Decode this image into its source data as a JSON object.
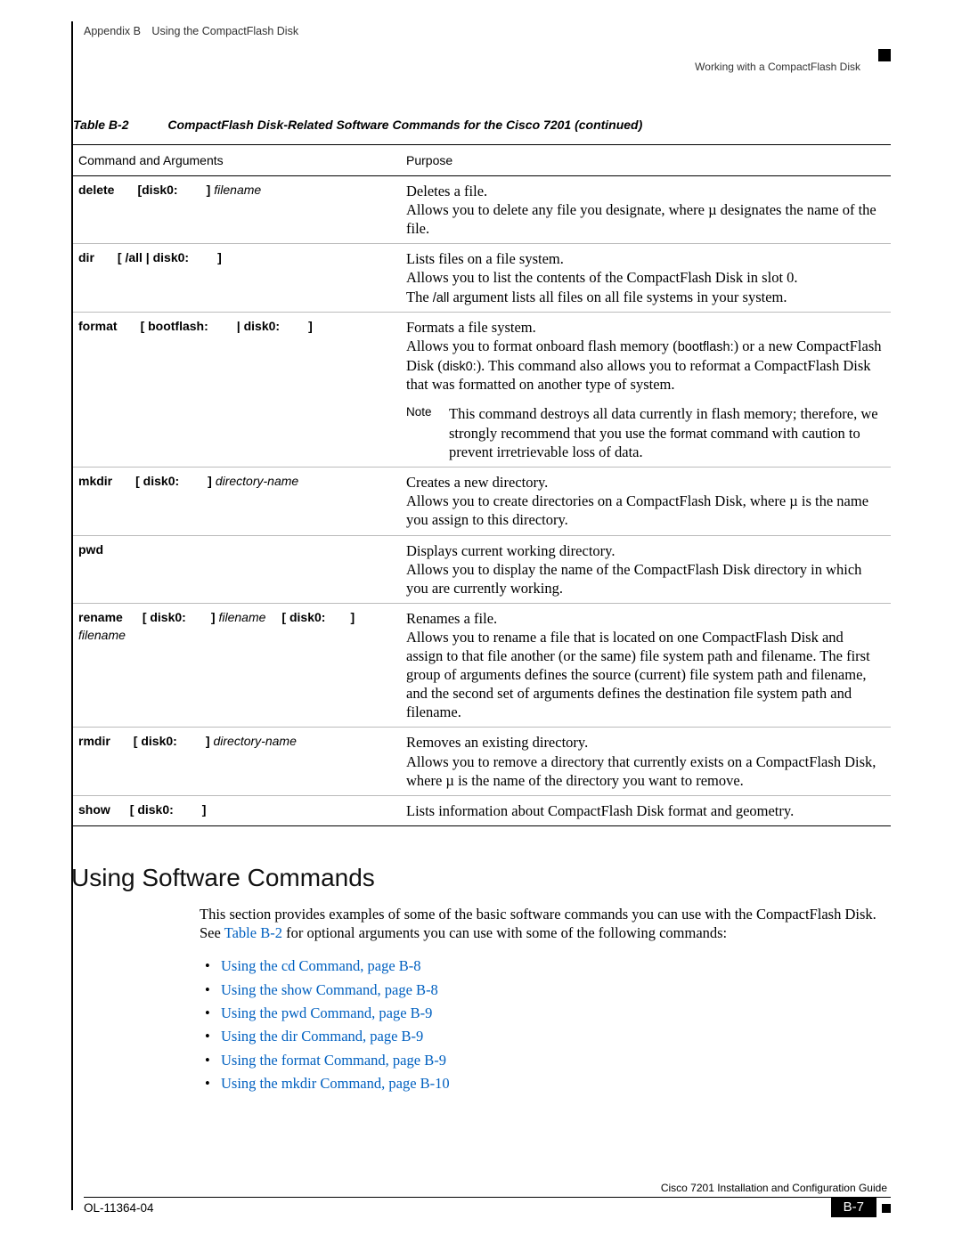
{
  "header": {
    "left": "Appendix B Using the CompactFlash Disk",
    "right": "Working with a CompactFlash Disk"
  },
  "table": {
    "number": "Table B-2",
    "title": "CompactFlash Disk-Related Software Commands for the Cisco 7201 (continued)",
    "head_col1": "Command and Arguments",
    "head_col2": "Purpose",
    "rows": [
      {
        "cmd": "delete",
        "args1": "[disk0:",
        "args2": "]",
        "ital": "filename",
        "purpose_line1": "Deletes a file.",
        "purpose_rest": "Allows you to delete any file you designate, where µ designates the name of the file."
      },
      {
        "cmd": "dir",
        "args1": "[ /all | disk0:",
        "args2": "]",
        "purpose_line1": "Lists files on a file system.",
        "purpose_l2a": "Allows you to list the contents of the CompactFlash Disk in slot 0.",
        "purpose_l3a": "The ",
        "all_arg": "/all",
        "purpose_l3b": " argument lists all files on all file systems in your system."
      },
      {
        "cmd": "format",
        "args1": "[ bootflash:",
        "args2": " | disk0:",
        "args3": "]",
        "purpose_line1": "Formats a file system.",
        "p2a": "Allows you to format onboard flash memory (",
        "bootflash": "bootflash:",
        "p2b": ") or a new CompactFlash Disk (",
        "disk0": "disk0:",
        "p2c": "). This command also allows you to reformat a CompactFlash Disk that was formatted on another type of system.",
        "note_label": "Note",
        "note_a": "This command destroys all data currently in flash memory; therefore, we strongly recommend that you use the ",
        "fmt": "format",
        "note_b": " command with caution to prevent irretrievable loss of data."
      },
      {
        "cmd": "mkdir",
        "args1": "[ disk0:",
        "args2": "]",
        "ital": "directory-name",
        "purpose_line1": "Creates a new directory.",
        "p2": "Allows you to create directories on a CompactFlash Disk, where µ is the name you assign to this directory."
      },
      {
        "cmd": "pwd",
        "purpose_line1": "Displays current working directory.",
        "p2": "Allows you to display the name of the CompactFlash Disk directory in which you are currently working."
      },
      {
        "cmd": "rename",
        "args1": "[ disk0:",
        "args2": "]",
        "ital1": "filename",
        "args3": "[ disk0:",
        "args4": "]",
        "ital2": "filename",
        "purpose_line1": "Renames a file.",
        "p2": "Allows you to rename a file that is located on one CompactFlash Disk and assign to that file another (or the same) file system path and filename. The first group of arguments defines the source (current) file system path and filename, and the second set of arguments defines the destination file system path and filename."
      },
      {
        "cmd": "rmdir",
        "args1": "[ disk0:",
        "args2": "]",
        "ital": "directory-name",
        "purpose_line1": "Removes an existing directory.",
        "p2": "Allows you to remove a directory that currently exists on a CompactFlash Disk, where µ is the name of the directory you want to remove."
      },
      {
        "cmd": "show",
        "args1": "[ disk0:",
        "args2": "]",
        "p": "Lists information about CompactFlash Disk format and geometry."
      }
    ]
  },
  "section": {
    "heading": "Using Software Commands",
    "intro_a": "This section provides examples of some of the basic software commands you can use with the CompactFlash Disk. See ",
    "xref": "Table B-2",
    "intro_b": " for optional arguments you can use with some of the following commands:",
    "links": [
      "Using the cd Command, page B-8",
      "Using the show Command, page B-8",
      "Using the pwd Command, page B-9",
      "Using the dir Command, page B-9",
      "Using the format Command, page B-9",
      "Using the mkdir Command, page B-10"
    ]
  },
  "footer": {
    "guide": "Cisco 7201 Installation and Configuration Guide",
    "docnum": "OL-11364-04",
    "pagenum": "B-7"
  }
}
